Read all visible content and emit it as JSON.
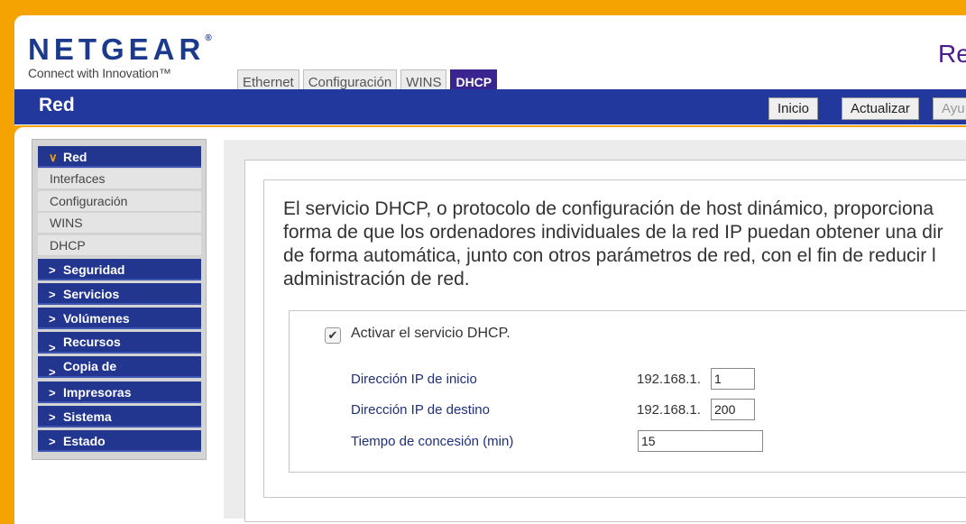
{
  "header": {
    "brand": "NETGEAR",
    "registered": "®",
    "tagline": "Connect with Innovation™",
    "page_heading": "Re"
  },
  "tabs": [
    {
      "label": "Ethernet",
      "active": false
    },
    {
      "label": "Configuración",
      "active": false
    },
    {
      "label": "WINS",
      "active": false
    },
    {
      "label": "DHCP",
      "active": true
    }
  ],
  "titlebar": {
    "title": "Red",
    "buttons": [
      "Inicio",
      "Actualizar",
      "Ayu"
    ]
  },
  "sidebar": {
    "open_section": "Red",
    "items": [
      "Interfaces",
      "Configuración",
      "WINS",
      "DHCP"
    ],
    "sections": [
      "Seguridad",
      "Servicios",
      "Volúmenes",
      "Recursos",
      "Copia de",
      "Impresoras",
      "Sistema",
      "Estado"
    ]
  },
  "content": {
    "description_lines": [
      "El servicio DHCP, o protocolo de configuración de host dinámico, proporciona",
      "forma de que los ordenadores individuales de la red IP puedan obtener una dir",
      "de forma automática, junto con otros parámetros de red, con el fin de reducir l",
      "administración de red."
    ],
    "enable_label": "Activar el servicio DHCP.",
    "enabled": true,
    "start_ip_label": "Dirección IP de inicio",
    "start_ip_prefix": "192.168.1.",
    "start_ip_value": "1",
    "end_ip_label": "Dirección IP de destino",
    "end_ip_prefix": "192.168.1.",
    "end_ip_value": "200",
    "lease_label": "Tiempo de concesión (min)",
    "lease_value": "15"
  },
  "colors": {
    "accent": "#f5a300",
    "navy": "#23389c",
    "active_tab": "#3a2590"
  }
}
